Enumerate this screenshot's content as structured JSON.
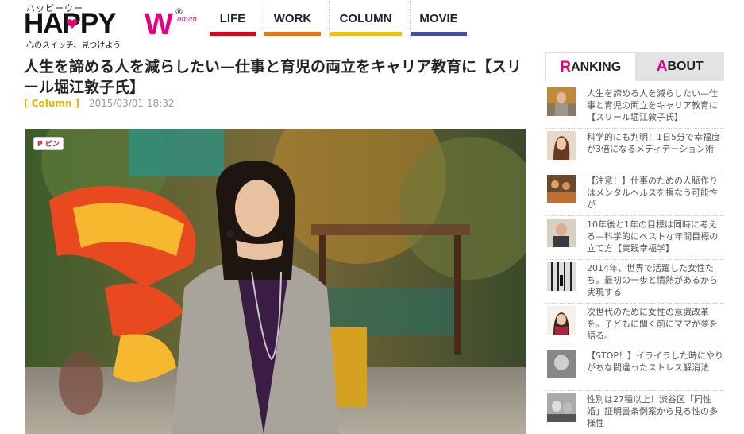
{
  "logo": {
    "kana": "ハッピーウー",
    "happy_prefix": "HAPPY",
    "w": "W",
    "reg": "®",
    "oman": "oman",
    "tagline": "心のスイッチ、見つけよう"
  },
  "nav": [
    {
      "label": "LIFE",
      "color": "#e60012"
    },
    {
      "label": "WORK",
      "color": "#ee7800"
    },
    {
      "label": "COLUMN",
      "color": "#f3c000"
    },
    {
      "label": "MOVIE",
      "color": "#3f51a3"
    }
  ],
  "article": {
    "title": "人生を諦める人を減らしたい—仕事と育児の両立をキャリア教育に【スリール堀江敦子氏】",
    "category": "[ Column ]",
    "date": "2015/03/01 18:32",
    "pin_label": "ピン"
  },
  "sidebar": {
    "tab_ranking_first": "R",
    "tab_ranking_rest": "ANKING",
    "tab_about_first": "A",
    "tab_about_rest": "BOUT",
    "items": [
      {
        "text": "人生を諦める人を減らしたい—仕事と育児の両立をキャリア教育に【スリール堀江敦子氏】"
      },
      {
        "text": "科学的にも判明！1日5分で幸福度が3倍になるメディテーション術"
      },
      {
        "text": "【注意！】仕事のための人脈作りはメンタルヘルスを損なう可能性が"
      },
      {
        "text": "10年後と1年の目標は同時に考える—科学的にベストな年間目標の立て方【実践幸福学】"
      },
      {
        "text": "2014年、世界で活躍した女性たち。最初の一歩と情熱があるから実現する"
      },
      {
        "text": "次世代のために女性の意識改革を。子どもに聞く前にママが夢を語る。"
      },
      {
        "text": "【STOP！】イライラした時にやりがちな間違ったストレス解消法"
      },
      {
        "text": "性別は27種以上！渋谷区「同性婚」証明書条例案から見る性の多様性"
      }
    ]
  }
}
